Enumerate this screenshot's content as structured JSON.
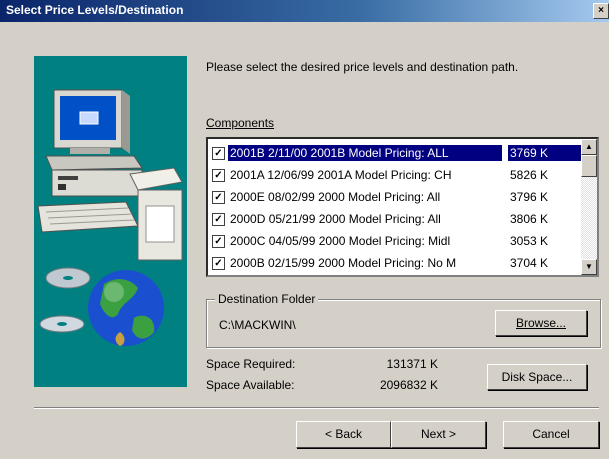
{
  "window": {
    "title": "Select Price Levels/Destination",
    "close_glyph": "×"
  },
  "intro_text": "Please select the desired price levels and destination path.",
  "components": {
    "label": "Components",
    "items": [
      {
        "name": "2001B 2/11/00 2001B Model Pricing: ALL",
        "size": "3769 K",
        "checked": true,
        "selected": true
      },
      {
        "name": "2001A 12/06/99 2001A Model Pricing: CH",
        "size": "5826 K",
        "checked": true,
        "selected": false
      },
      {
        "name": "2000E 08/02/99 2000 Model Pricing: All",
        "size": "3796 K",
        "checked": true,
        "selected": false
      },
      {
        "name": "2000D 05/21/99 2000 Model Pricing: All",
        "size": "3806 K",
        "checked": true,
        "selected": false
      },
      {
        "name": "2000C 04/05/99 2000 Model Pricing: Midl",
        "size": "3053 K",
        "checked": true,
        "selected": false
      },
      {
        "name": "2000B 02/15/99 2000 Model Pricing: No M",
        "size": "3704 K",
        "checked": true,
        "selected": false
      }
    ]
  },
  "destination": {
    "group_label": "Destination Folder",
    "path": "C:\\MACKWIN\\",
    "browse_label": "Browse..."
  },
  "space": {
    "required_label": "Space Required:",
    "required_value": "131371 K",
    "available_label": "Space Available:",
    "available_value": "2096832 K",
    "disk_space_label": "Disk Space..."
  },
  "buttons": {
    "back": "< Back",
    "next": "Next >",
    "cancel": "Cancel"
  },
  "colors": {
    "title_bar": "#0a246a",
    "art_background": "#008080",
    "selection": "#000080"
  }
}
